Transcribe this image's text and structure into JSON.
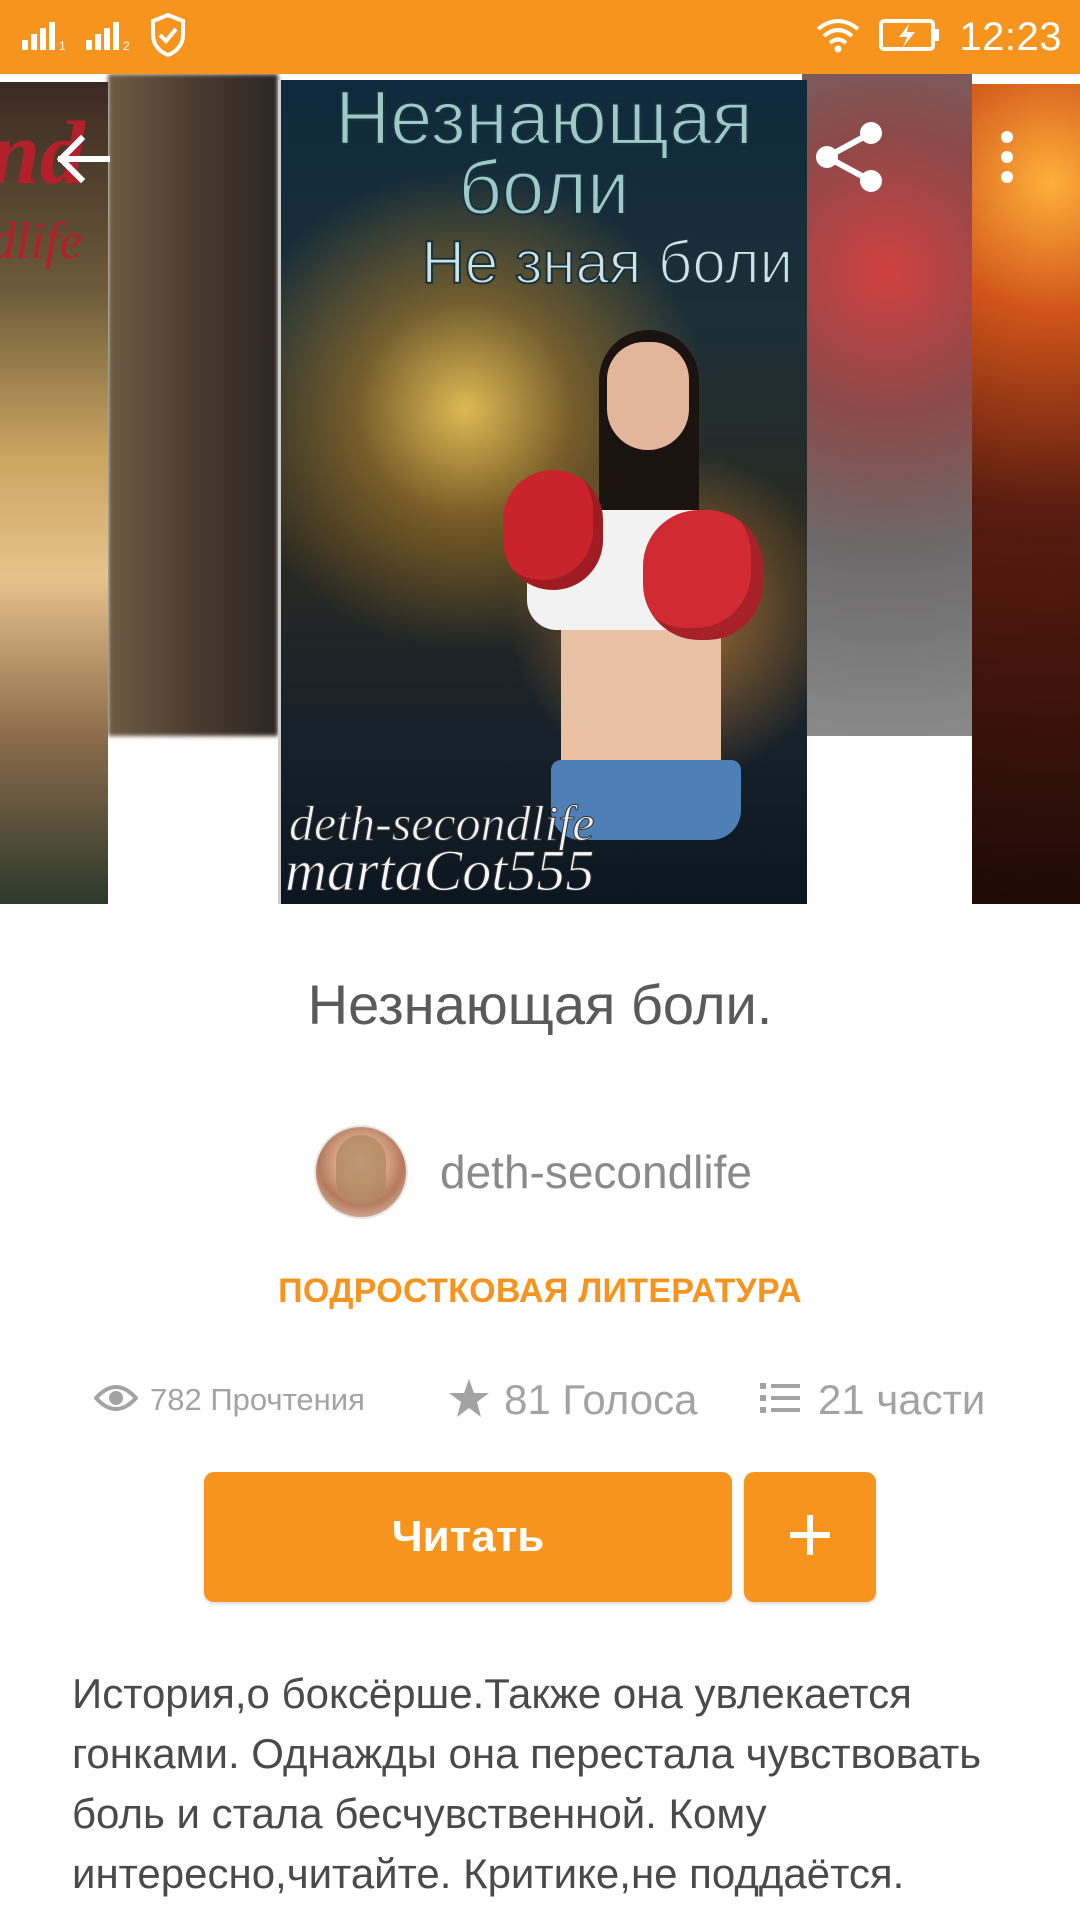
{
  "status_bar": {
    "time": "12:23",
    "sim1_label": "1",
    "sim2_label": "2",
    "icons": [
      "signal-sim1-icon",
      "signal-sim2-icon",
      "shield-check-icon",
      "wifi-icon",
      "battery-charging-icon"
    ]
  },
  "toolbar": {
    "icons": [
      "back-arrow-icon",
      "share-icon",
      "more-vert-icon"
    ]
  },
  "cover": {
    "title_line1": "Незнающая",
    "title_line2": "боли",
    "subtitle": "Не зная боли",
    "author_line1": "deth-secondlife",
    "author_line2": "martaCot555",
    "left_cover_text1": "nd",
    "left_cover_text2": "dlife"
  },
  "story": {
    "title": "Незнающая боли.",
    "author": "deth-secondlife",
    "category": "ПОДРОСТКОВАЯ ЛИТЕРАТУРА",
    "stats": {
      "reads": "782 Прочтения",
      "votes": "81 Голоса",
      "parts": "21 части"
    },
    "read_button": "Читать",
    "add_button_icon": "plus-icon",
    "description": "История,о боксёрше.Также она увлекается гонками. Однажды она перестала чувствовать боль и стала бесчувственной. Кому интересно,читайте. Критике,не поддаётся."
  },
  "colors": {
    "accent": "#f7941e",
    "title_text": "#5a5a5a",
    "muted_text": "#a3a3a3",
    "body_text": "#4a4a4a"
  }
}
